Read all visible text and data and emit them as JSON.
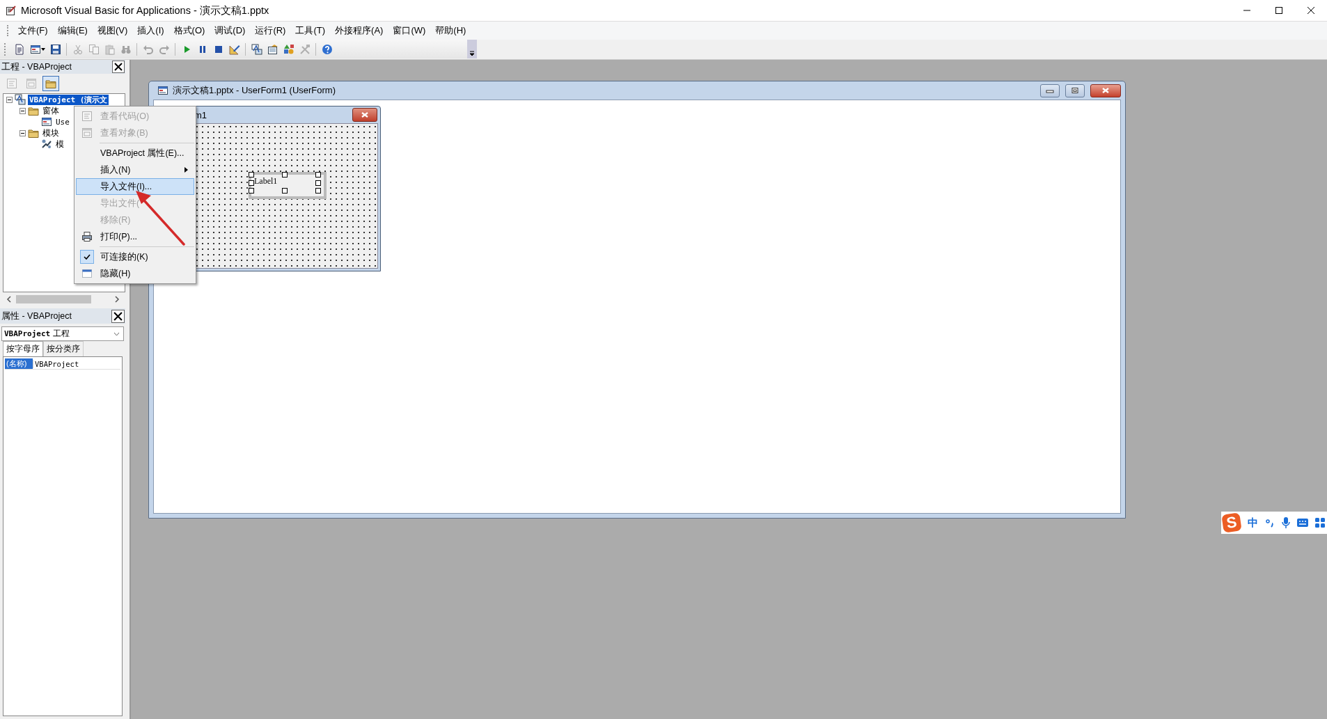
{
  "window": {
    "title": "Microsoft Visual Basic for Applications - 演示文稿1.pptx"
  },
  "menu": [
    "文件(F)",
    "编辑(E)",
    "视图(V)",
    "插入(I)",
    "格式(O)",
    "调试(D)",
    "运行(R)",
    "工具(T)",
    "外接程序(A)",
    "窗口(W)",
    "帮助(H)"
  ],
  "toolbar": [
    {
      "kind": "document",
      "disabled": false
    },
    {
      "kind": "form",
      "disabled": false
    },
    {
      "kind": "save",
      "disabled": false
    },
    {
      "kind": "separator"
    },
    {
      "kind": "cut",
      "disabled": true
    },
    {
      "kind": "copy",
      "disabled": true
    },
    {
      "kind": "paste",
      "disabled": true
    },
    {
      "kind": "find",
      "disabled": true
    },
    {
      "kind": "separator"
    },
    {
      "kind": "undo",
      "disabled": true
    },
    {
      "kind": "redo",
      "disabled": true
    },
    {
      "kind": "separator"
    },
    {
      "kind": "run",
      "disabled": false
    },
    {
      "kind": "pause",
      "disabled": false
    },
    {
      "kind": "stop",
      "disabled": false
    },
    {
      "kind": "design",
      "disabled": false
    },
    {
      "kind": "separator"
    },
    {
      "kind": "project",
      "disabled": false
    },
    {
      "kind": "properties",
      "disabled": false
    },
    {
      "kind": "objects",
      "disabled": false
    },
    {
      "kind": "toolbox",
      "disabled": true
    },
    {
      "kind": "separator"
    },
    {
      "kind": "help",
      "disabled": false
    }
  ],
  "project_panel": {
    "title": "工程 - VBAProject",
    "toolbar": [
      {
        "kind": "code",
        "disabled": true,
        "pressed": false
      },
      {
        "kind": "object",
        "disabled": true,
        "pressed": false
      },
      {
        "kind": "folder",
        "disabled": false,
        "pressed": true
      }
    ],
    "tree": [
      {
        "label": "VBAProject (演示文",
        "kind": "project",
        "selected": true,
        "expanded": true,
        "children": [
          {
            "label": "窗体",
            "kind": "folder",
            "selected": false,
            "expanded": true,
            "children": [
              {
                "label": "Use",
                "kind": "form",
                "selected": false
              }
            ]
          },
          {
            "label": "模块",
            "kind": "folder",
            "selected": false,
            "expanded": true,
            "children": [
              {
                "label": "模",
                "kind": "module",
                "selected": false
              }
            ]
          }
        ]
      }
    ]
  },
  "properties_panel": {
    "title": "属性 - VBAProject",
    "object": "**VBAProject** 工程",
    "tabs": [
      {
        "label": "按字母序",
        "selected": true
      },
      {
        "label": "按分类序",
        "selected": false
      }
    ],
    "rows": [
      {
        "name": "(名称)",
        "value": "VBAProject",
        "selected": true
      }
    ]
  },
  "code_window": {
    "title": "演示文稿1.pptx - UserForm1 (UserForm)",
    "form": {
      "title": "m1",
      "controls": [
        {
          "label": "Label1",
          "selected": true
        }
      ]
    }
  },
  "context_menu": {
    "items": [
      {
        "kind": "code",
        "label": "查看代码(O)",
        "disabled": true,
        "selected": false,
        "checked": false,
        "submenu": false
      },
      {
        "kind": "object",
        "label": "查看对象(B)",
        "disabled": true,
        "selected": false,
        "checked": false,
        "submenu": false
      },
      {
        "kind": "separator"
      },
      {
        "kind": "plain",
        "label": "VBAProject 属性(E)...",
        "disabled": false,
        "selected": false,
        "checked": false,
        "submenu": false
      },
      {
        "kind": "plain",
        "label": "插入(N)",
        "disabled": false,
        "selected": false,
        "checked": false,
        "submenu": true
      },
      {
        "kind": "plain",
        "label": "导入文件(I)...",
        "disabled": false,
        "selected": true,
        "checked": false,
        "submenu": false
      },
      {
        "kind": "plain",
        "label": "导出文件(",
        "disabled": true,
        "selected": false,
        "checked": false,
        "submenu": false
      },
      {
        "kind": "plain",
        "label": "移除(R)",
        "disabled": true,
        "selected": false,
        "checked": false,
        "submenu": false
      },
      {
        "kind": "print",
        "label": "打印(P)...",
        "disabled": false,
        "selected": false,
        "checked": false,
        "submenu": false
      },
      {
        "kind": "separator"
      },
      {
        "kind": "plain",
        "label": "可连接的(K)",
        "disabled": false,
        "selected": false,
        "checked": true,
        "submenu": false
      },
      {
        "kind": "hide",
        "label": "隐藏(H)",
        "disabled": false,
        "selected": false,
        "checked": false,
        "submenu": false
      }
    ]
  },
  "ime_bar": {
    "logo": "S",
    "mode": "中"
  }
}
